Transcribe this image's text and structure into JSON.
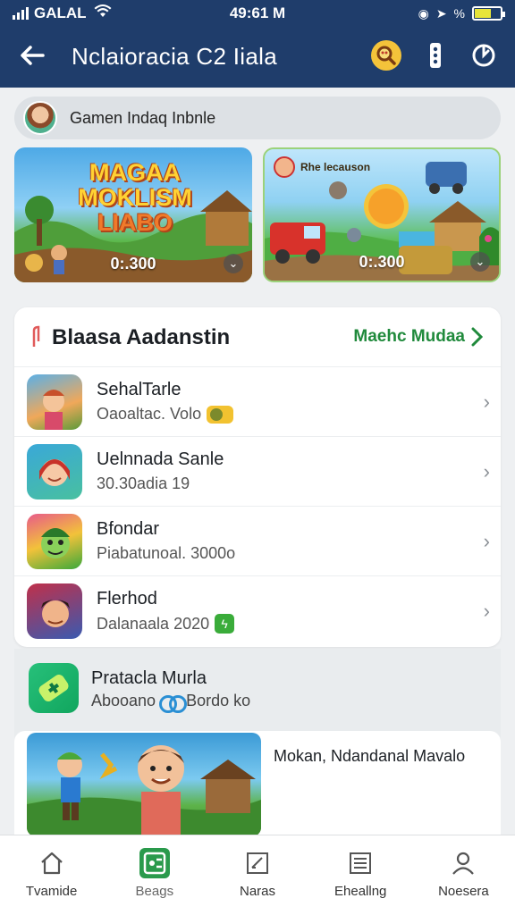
{
  "status_bar": {
    "carrier": "GALAL",
    "time": "49:61 M",
    "battery_level": 0.65
  },
  "nav": {
    "title": "Nclaioracia C2 Iiala"
  },
  "search": {
    "text": "Gamen Indaq Inbnle"
  },
  "banners": [
    {
      "logo_line1": "MAGAA",
      "logo_line2": "MOKLISM",
      "logo_line3": "LIABO",
      "duration": "0:.300"
    },
    {
      "tag": "Rhe lecauson",
      "duration": "0:.300"
    }
  ],
  "list_section": {
    "title": "Blaasa Aadanstin",
    "see_more": "Maehc Mudaa",
    "items": [
      {
        "name": "SehalTarle",
        "subtitle": "Oaoaltac. Volo"
      },
      {
        "name": "Uelnnada Sanle",
        "subtitle": "30.30adia 19"
      },
      {
        "name": "Bfondar",
        "subtitle": "Piabatunoal. 3000o"
      },
      {
        "name": "Flerhod",
        "subtitle": "Dalanaala 2020"
      }
    ]
  },
  "app_promo": {
    "name": "Pratacla Murla",
    "subtitle_left": "Abooano",
    "subtitle_right": "Bordo ko"
  },
  "feature": {
    "text": "Mokan, Ndandanal Mavalo"
  },
  "tabs": [
    {
      "label": "Tvamide",
      "icon": "home-icon"
    },
    {
      "label": "Beags",
      "icon": "games-icon"
    },
    {
      "label": "Naras",
      "icon": "edit-icon"
    },
    {
      "label": "Eheallng",
      "icon": "list-icon"
    },
    {
      "label": "Noesera",
      "icon": "profile-icon"
    }
  ],
  "colors": {
    "header": "#1f3d6b",
    "accent_green": "#208a3c",
    "search_btn": "#f4c33a"
  }
}
